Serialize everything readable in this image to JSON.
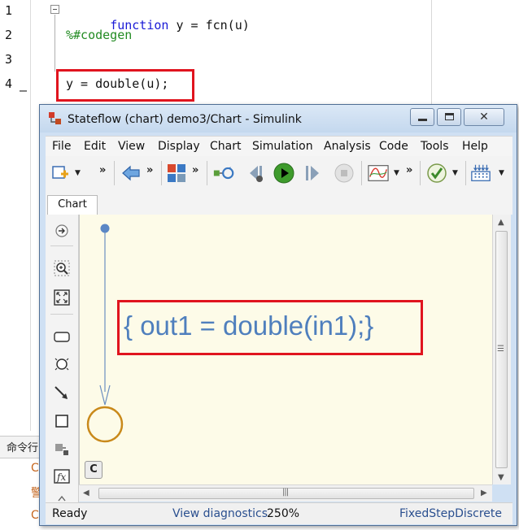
{
  "editor": {
    "line_numbers": [
      "1",
      "2",
      "3",
      "4"
    ],
    "current_line_marker": "—",
    "line1_keyword": "function",
    "line1_rest": " y = fcn(u)",
    "line2_comment": "%#codegen",
    "line4_code": "y = double(u);",
    "command_window_label": "命令行",
    "command_marks": [
      "C",
      "警",
      "C"
    ]
  },
  "window": {
    "title": "Stateflow (chart) demo3/Chart - Simulink",
    "close_glyph": "✕"
  },
  "menubar": {
    "items": [
      "File",
      "Edit",
      "View",
      "Display",
      "Chart",
      "Simulation",
      "Analysis",
      "Code",
      "Tools",
      "Help"
    ]
  },
  "toolbar": {
    "more_glyph": "»",
    "dropdown_glyph": "▼",
    "icons": [
      "add-block-icon",
      "back-arrow-icon",
      "library-browser-icon",
      "update-diagram-icon",
      "step-back-icon",
      "run-icon",
      "step-forward-icon",
      "stop-icon",
      "scope-icon",
      "model-advisor-icon",
      "build-icon"
    ]
  },
  "tabs": {
    "chart_tab": "Chart"
  },
  "palette": {
    "icons": [
      "navigate-up-icon",
      "zoom-icon",
      "fit-view-icon",
      "state-icon",
      "junction-icon",
      "transition-icon",
      "box-icon",
      "graphical-function-icon",
      "matlab-function-icon"
    ]
  },
  "canvas": {
    "transition_label": "{ out1 =  double(in1);}",
    "c_badge": "C"
  },
  "scroll": {
    "up": "▲",
    "down": "▼",
    "left": "◀",
    "right": "▶",
    "grip": "|||",
    "vgrip": "☰"
  },
  "status": {
    "ready": "Ready",
    "diagnostics": "View diagnostics",
    "zoom": "250%",
    "solver": "FixedStepDiscrete"
  },
  "colors": {
    "accent_red": "#e0141e",
    "label_blue": "#4f7fbd",
    "junction_orange": "#c9891a",
    "canvas_bg": "#fdfbe8"
  }
}
